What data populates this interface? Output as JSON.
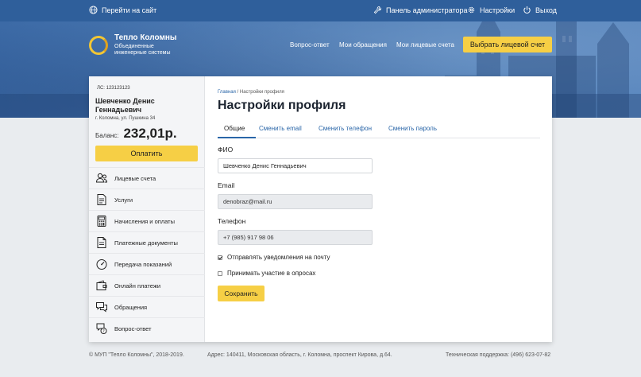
{
  "topbar": {
    "site_link": "Перейти на сайт",
    "admin_panel": "Панель администратора",
    "settings": "Настройки",
    "logout": "Выход"
  },
  "logo": {
    "title": "Тепло Коломны",
    "subtitle_line1": "Объединенные",
    "subtitle_line2": "инженерные системы"
  },
  "nav": {
    "items": [
      "Вопрос-ответ",
      "Мои обращения",
      "Мои лицевые счета"
    ],
    "choose_account": "Выбрать лицевой счет"
  },
  "account": {
    "ls": "ЛС: 123123123",
    "name": "Шевченко Денис Геннадьевич",
    "address": "г. Коломна, ул. Пушкина 34",
    "balance_label": "Баланс:",
    "balance_value": "232,01р.",
    "pay_button": "Оплатить"
  },
  "menu": {
    "items": [
      {
        "label": "Лицевые счета",
        "icon": "users-icon"
      },
      {
        "label": "Услуги",
        "icon": "document-icon"
      },
      {
        "label": "Начисления и оплаты",
        "icon": "calculator-icon"
      },
      {
        "label": "Платежные документы",
        "icon": "receipt-icon"
      },
      {
        "label": "Передача показаний",
        "icon": "gauge-icon"
      },
      {
        "label": "Онлайн платежи",
        "icon": "wallet-icon"
      },
      {
        "label": "Обращения",
        "icon": "chat-icon"
      },
      {
        "label": "Вопрос-ответ",
        "icon": "question-icon"
      }
    ]
  },
  "breadcrumb": {
    "home": "Главная",
    "separator": "/",
    "current": "Настройки профиля"
  },
  "page_title": "Настройки профиля",
  "tabs": [
    "Общие",
    "Сменить email",
    "Сменить телефон",
    "Сменить пароль"
  ],
  "form": {
    "fio_label": "ФИО",
    "fio_value": "Шевченко Денис Геннадьевич",
    "email_label": "Email",
    "email_value": "denobraz@mail.ru",
    "phone_label": "Телефон",
    "phone_value": "+7 (985) 917 98 06",
    "notify_email": {
      "label": "Отправлять уведомления на почту",
      "checked": true
    },
    "surveys": {
      "label": "Принимать участие в опросах",
      "checked": false
    },
    "save_button": "Сохранить"
  },
  "footer": {
    "copyright": "© МУП \"Тепло Коломны\", 2018-2019.",
    "address": "Адрес: 140411, Московская область, г. Коломна, проспект Кирова, д.64.",
    "support": "Техническая поддержка: (496) 623-07-82"
  },
  "colors": {
    "accent_yellow": "#f6cf45",
    "link_blue": "#2a66a8",
    "header_blue": "#2f5f9b"
  }
}
